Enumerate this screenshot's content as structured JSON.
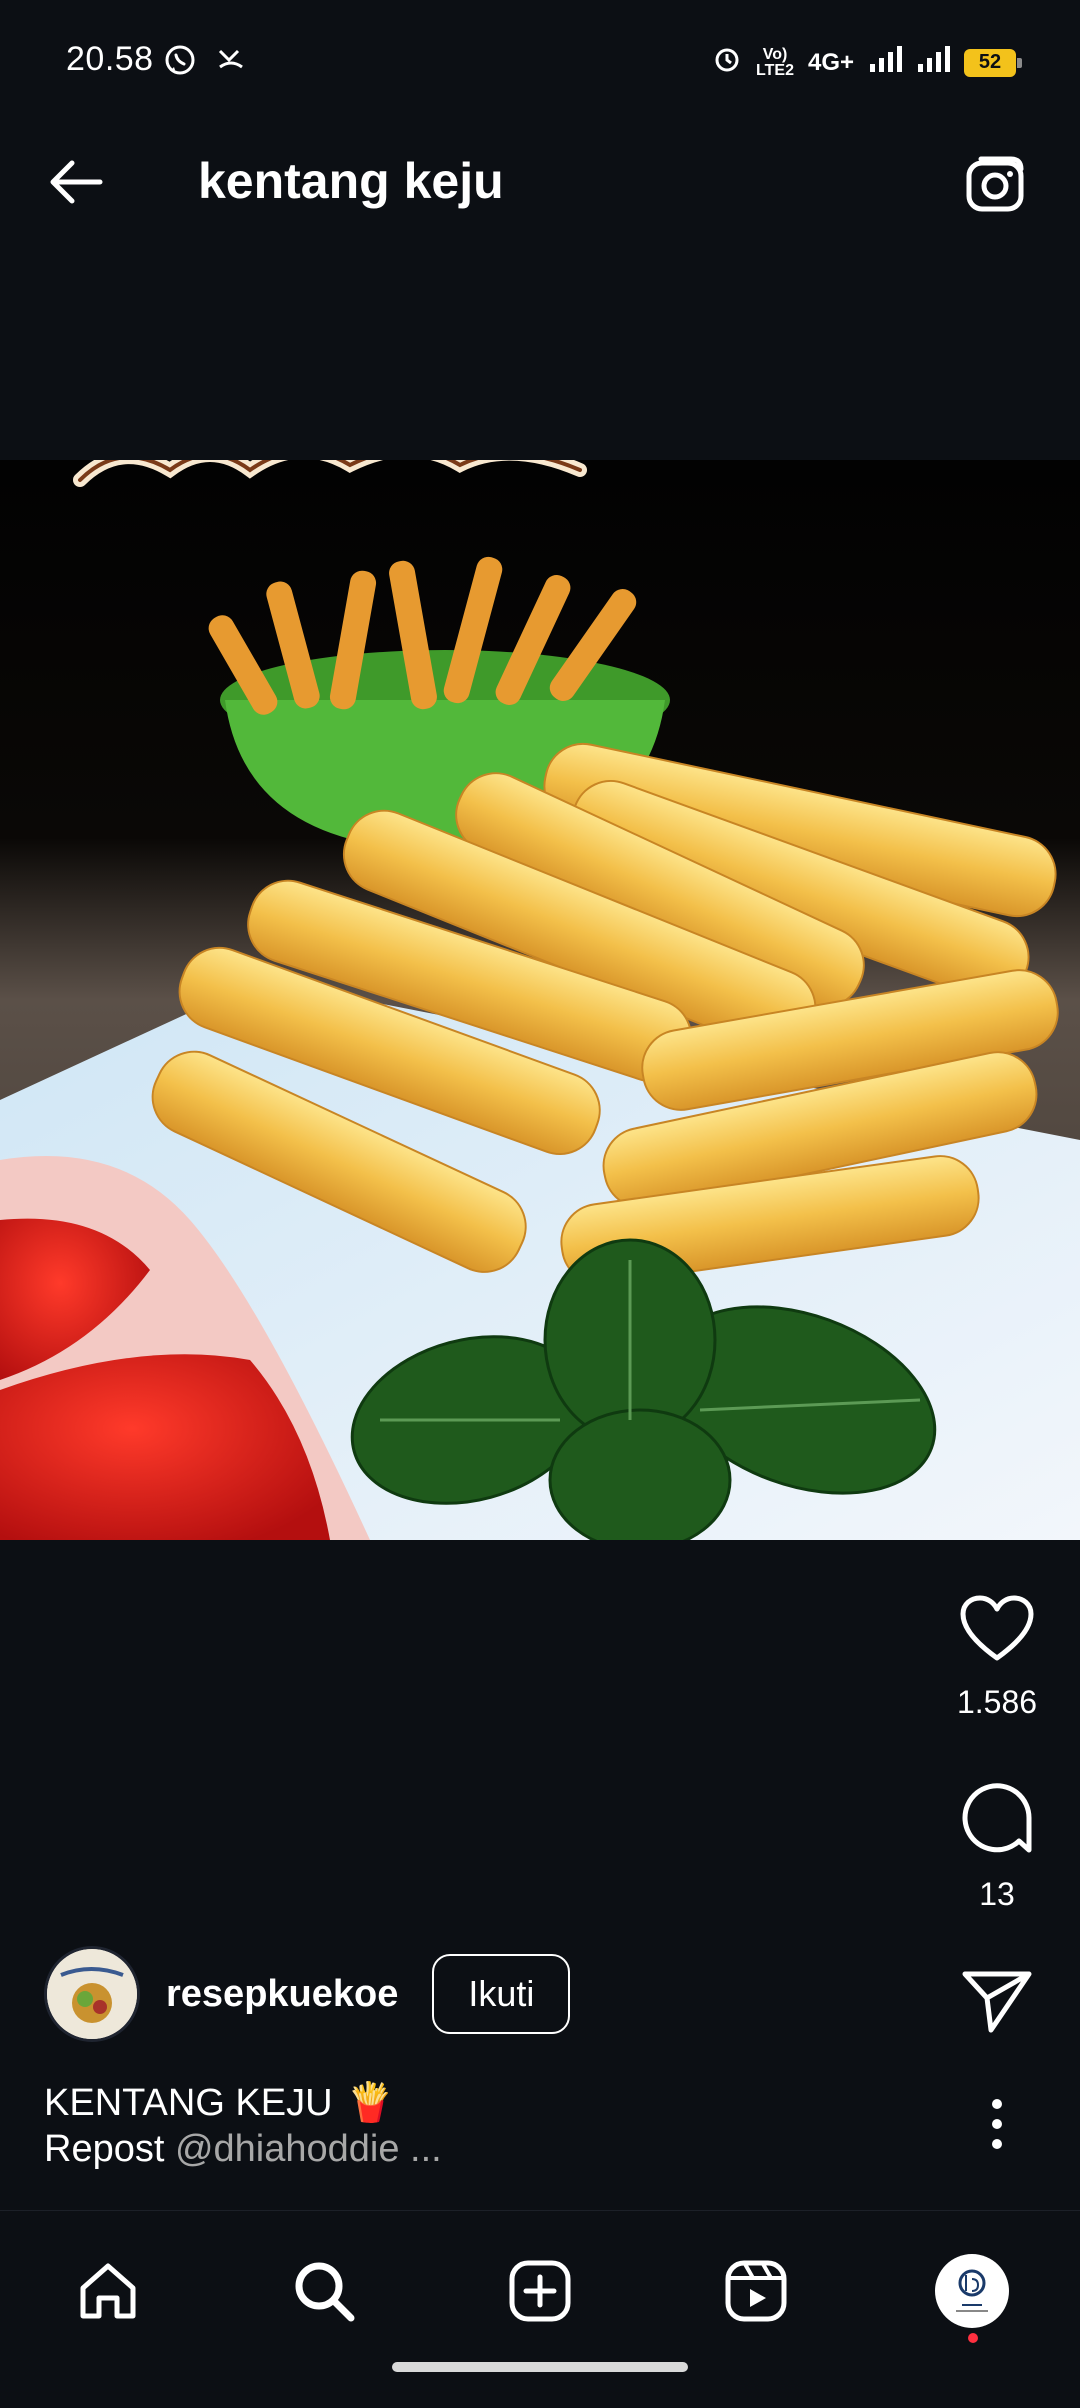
{
  "status_bar": {
    "time": "20.58",
    "network_label": "4G+",
    "volte_label": "VoLTE2",
    "battery_level": "52",
    "icons": [
      "whatsapp-icon",
      "missed-call-icon",
      "alarm-icon",
      "volte-icon",
      "signal-icon",
      "signal-icon",
      "battery-icon"
    ]
  },
  "header": {
    "title": "kentang keju",
    "back_icon": "arrow-left-icon",
    "camera_icon": "camera-icon"
  },
  "post": {
    "image_alt": "kentang keju",
    "likes": "1.586",
    "comments": "13",
    "author": {
      "username": "resepkuekoe",
      "follow_label": "Ikuti"
    },
    "caption": {
      "title": "KENTANG KEJU",
      "title_emoji": "🍟",
      "line2_prefix": "Repost",
      "line2_mention": "@dhiahoddie ..."
    }
  },
  "bottom_nav": {
    "items": [
      "home-icon",
      "search-icon",
      "add-post-icon",
      "reels-icon",
      "profile-avatar"
    ]
  },
  "colors": {
    "background": "#0c0f14",
    "text": "#ffffff",
    "muted": "#a8a8a8",
    "battery": "#f3c21b",
    "notification_dot": "#ff3040"
  }
}
